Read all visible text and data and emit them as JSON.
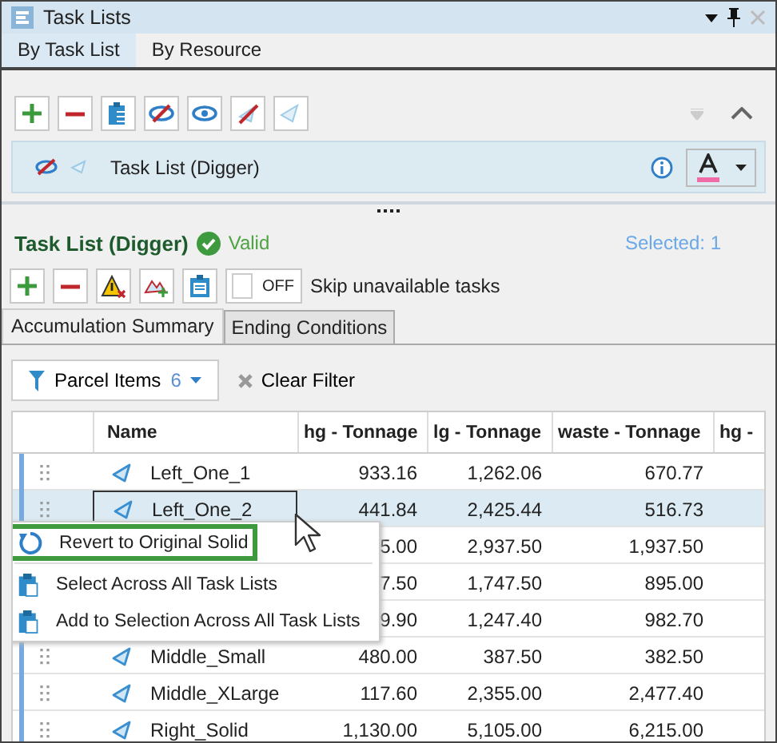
{
  "window": {
    "title": "Task Lists"
  },
  "tabs": [
    {
      "label": "By Task List",
      "selected": true
    },
    {
      "label": "By Resource",
      "selected": false
    }
  ],
  "task_list": {
    "name": "Task List (Digger)"
  },
  "header": {
    "title": "Task List (Digger)",
    "status": "Valid",
    "selected_count": "Selected: 1"
  },
  "skip_toggle": {
    "on": false,
    "state_label": "OFF",
    "label": "Skip unavailable tasks"
  },
  "subtabs": [
    {
      "label": "Accumulation Summary",
      "selected": true
    },
    {
      "label": "Ending Conditions",
      "selected": false
    }
  ],
  "filter": {
    "label": "Parcel Items",
    "count": "6",
    "clear": "Clear Filter"
  },
  "table": {
    "columns": [
      "Name",
      "hg - Tonnage",
      "lg - Tonnage",
      "waste - Tonnage",
      "hg -"
    ],
    "rows": [
      {
        "cells": [
          "Left_One_1",
          "933.16",
          "1,262.06",
          "670.77"
        ],
        "selected": false
      },
      {
        "cells": [
          "Left_One_2",
          "441.84",
          "2,425.44",
          "516.73"
        ],
        "selected": true
      },
      {
        "cells": [
          "",
          "5.00",
          "2,937.50",
          "1,937.50"
        ],
        "selected": false
      },
      {
        "cells": [
          "",
          "7.50",
          "1,747.50",
          "895.00"
        ],
        "selected": false
      },
      {
        "cells": [
          "",
          "9.90",
          "1,247.40",
          "982.70"
        ],
        "selected": false
      },
      {
        "cells": [
          "Middle_Small",
          "480.00",
          "387.50",
          "382.50"
        ],
        "selected": false
      },
      {
        "cells": [
          "Middle_XLarge",
          "117.60",
          "2,355.00",
          "2,477.40"
        ],
        "selected": false
      },
      {
        "cells": [
          "Right_Solid",
          "1,130.00",
          "5,105.00",
          "6,215.00"
        ],
        "selected": false
      }
    ]
  },
  "context_menu": {
    "items": [
      {
        "kind": "revert",
        "label": "Revert to Original Solid",
        "selected": true
      },
      {
        "kind": "select",
        "label": "Select Across All Task Lists",
        "selected": false
      },
      {
        "kind": "select",
        "label": "Add to Selection Across All Task Lists",
        "selected": false
      }
    ]
  }
}
